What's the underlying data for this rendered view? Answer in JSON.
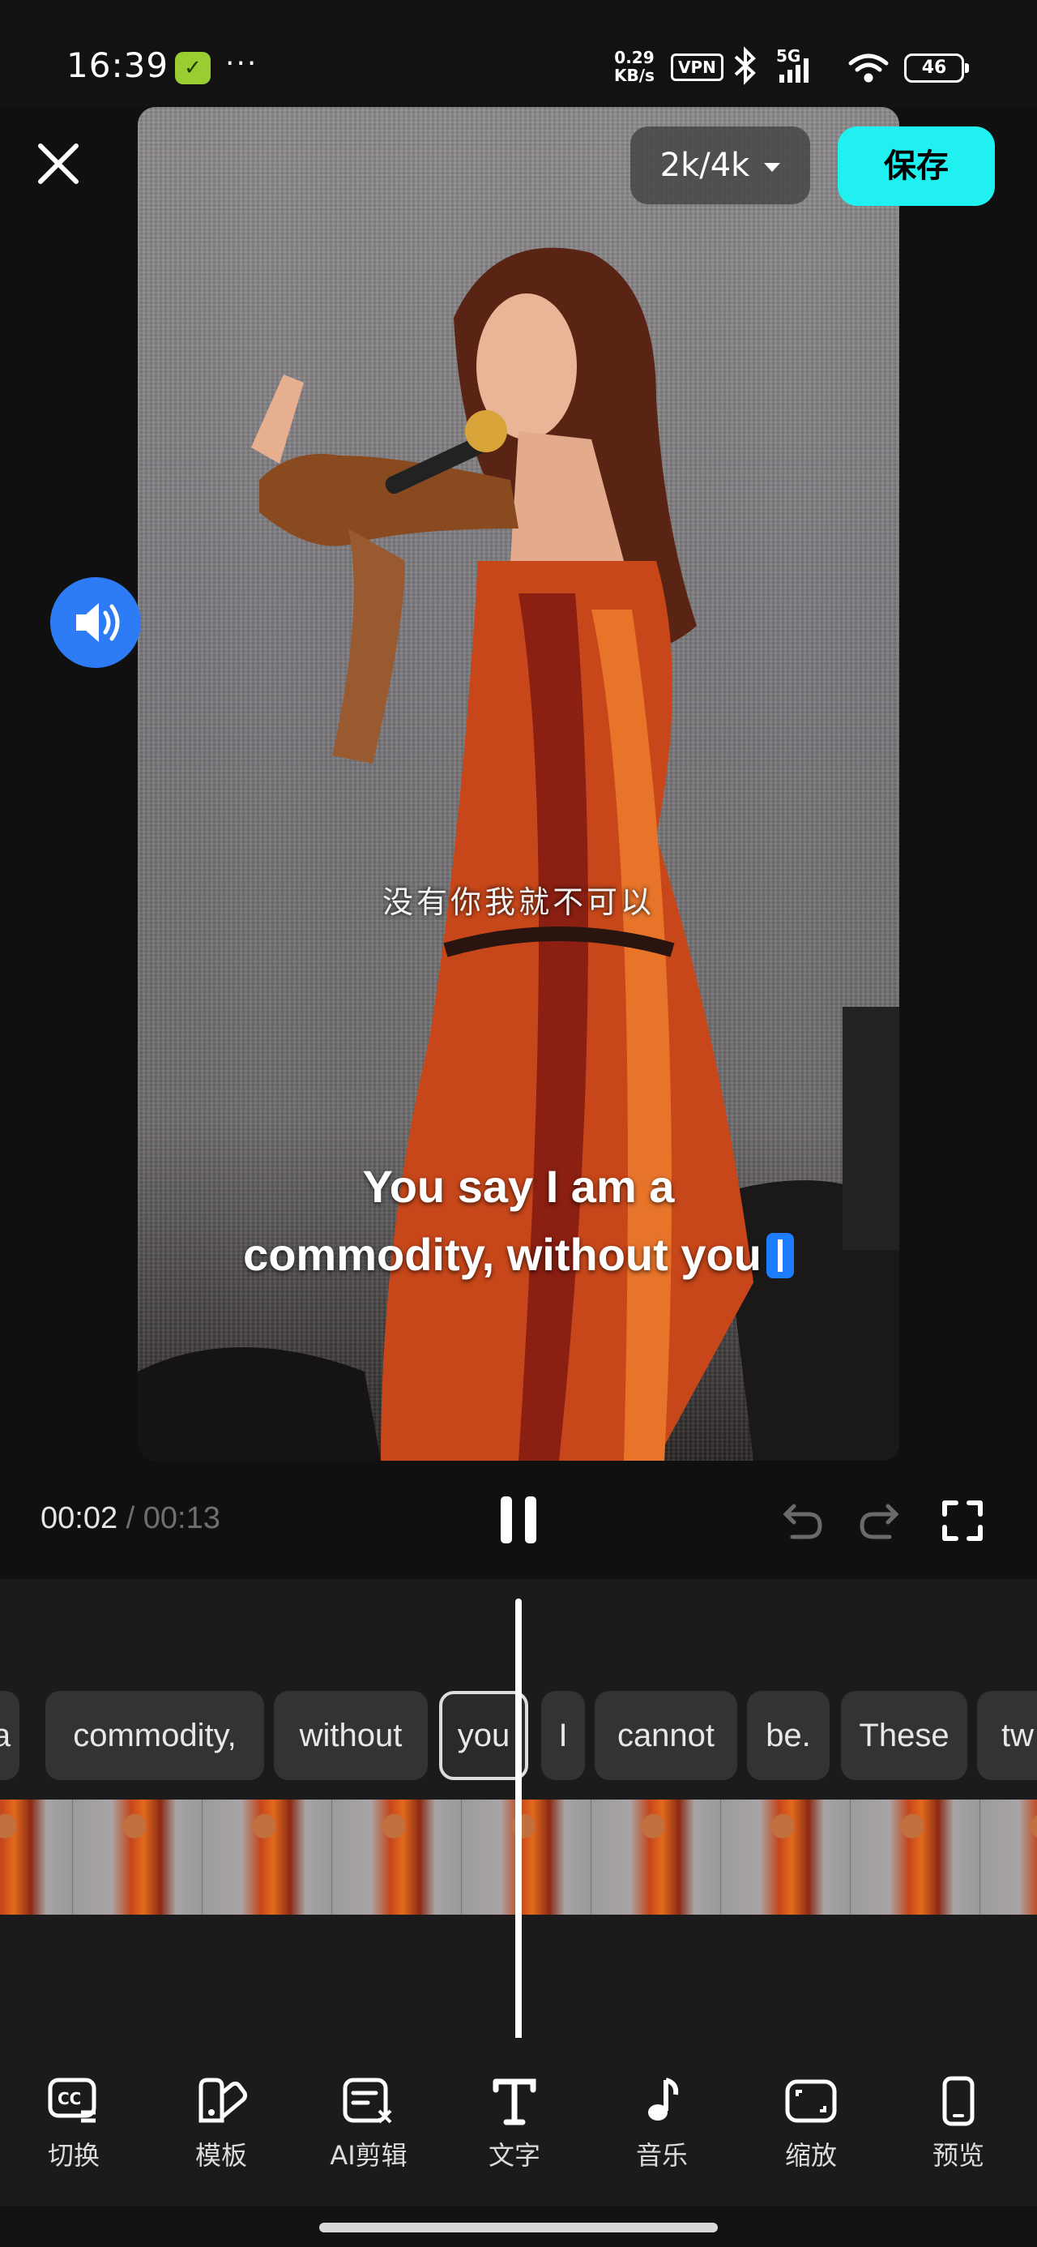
{
  "status_bar": {
    "time": "16:39",
    "net_speed_value": "0.29",
    "net_speed_unit": "KB/s",
    "vpn": "VPN",
    "network": "5G",
    "battery": "46"
  },
  "header": {
    "quality_label": "2k/4k",
    "save_label": "保存"
  },
  "video": {
    "caption_cn": "没有你我就不可以",
    "subtitle_line1": "You say I am a",
    "subtitle_line2": "commodity, without you"
  },
  "playback": {
    "current_time": "00:02",
    "separator": "/",
    "total_time": "00:13"
  },
  "timeline": {
    "words": [
      "a",
      "commodity,",
      "without",
      "you",
      "I",
      "cannot",
      "be.",
      "These",
      "tw"
    ],
    "active_index": 3
  },
  "toolbar": {
    "items": [
      {
        "label": "切换",
        "icon": "caption-switch-icon"
      },
      {
        "label": "模板",
        "icon": "template-icon"
      },
      {
        "label": "AI剪辑",
        "icon": "ai-edit-icon"
      },
      {
        "label": "文字",
        "icon": "text-icon"
      },
      {
        "label": "音乐",
        "icon": "music-icon"
      },
      {
        "label": "缩放",
        "icon": "zoom-icon"
      },
      {
        "label": "预览",
        "icon": "preview-icon"
      }
    ]
  },
  "colors": {
    "accent_cyan": "#20f0f0",
    "accent_blue": "#2d7cf6",
    "background": "#101010"
  }
}
